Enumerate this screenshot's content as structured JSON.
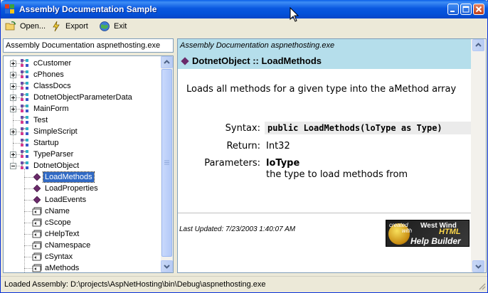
{
  "window": {
    "title": "Assembly Documentation Sample",
    "controls": [
      "minimize",
      "maximize",
      "close"
    ]
  },
  "menu": {
    "open_label": "Open...",
    "export_label": "Export",
    "exit_label": "Exit"
  },
  "path": {
    "value": "Assembly Documentation aspnethosting.exe"
  },
  "tree": {
    "items": [
      {
        "label": "cCustomer",
        "level": 0,
        "expander": "plus",
        "icon": "class-icon"
      },
      {
        "label": "cPhones",
        "level": 0,
        "expander": "plus",
        "icon": "class-icon"
      },
      {
        "label": "ClassDocs",
        "level": 0,
        "expander": "plus",
        "icon": "class-icon"
      },
      {
        "label": "DotnetObjectParameterData",
        "level": 0,
        "expander": "plus",
        "icon": "class-icon"
      },
      {
        "label": "MainForm",
        "level": 0,
        "expander": "plus",
        "icon": "class-icon"
      },
      {
        "label": "Test",
        "level": 0,
        "expander": "none",
        "icon": "class-icon"
      },
      {
        "label": "SimpleScript",
        "level": 0,
        "expander": "plus",
        "icon": "class-icon"
      },
      {
        "label": "Startup",
        "level": 0,
        "expander": "none",
        "icon": "class-icon"
      },
      {
        "label": "TypeParser",
        "level": 0,
        "expander": "plus",
        "icon": "class-icon"
      },
      {
        "label": "DotnetObject",
        "level": 0,
        "expander": "minus",
        "icon": "class-icon"
      },
      {
        "label": "LoadMethods",
        "level": 1,
        "expander": "none",
        "icon": "method-icon",
        "selected": true
      },
      {
        "label": "LoadProperties",
        "level": 1,
        "expander": "none",
        "icon": "method-icon"
      },
      {
        "label": "LoadEvents",
        "level": 1,
        "expander": "none",
        "icon": "method-icon"
      },
      {
        "label": "cName",
        "level": 1,
        "expander": "none",
        "icon": "property-icon"
      },
      {
        "label": "cScope",
        "level": 1,
        "expander": "none",
        "icon": "property-icon"
      },
      {
        "label": "cHelpText",
        "level": 1,
        "expander": "none",
        "icon": "property-icon"
      },
      {
        "label": "cNamespace",
        "level": 1,
        "expander": "none",
        "icon": "property-icon"
      },
      {
        "label": "cSyntax",
        "level": 1,
        "expander": "none",
        "icon": "property-icon"
      },
      {
        "label": "aMethods",
        "level": 1,
        "expander": "none",
        "icon": "property-icon"
      }
    ]
  },
  "doc": {
    "subtitle": "Assembly Documentation aspnethosting.exe",
    "title": "DotnetObject :: LoadMethods",
    "description": "Loads all methods for a given type into the aMethod array",
    "syntax_label": "Syntax:",
    "syntax_value": "public LoadMethods(loType as Type)",
    "return_label": "Return:",
    "return_value": "Int32",
    "params_label": "Parameters:",
    "param_name": "loType",
    "param_desc": "the type to load methods from",
    "updated": "Last Updated: 7/23/2003 1:40:07 AM",
    "badge": {
      "line1": "created",
      "line2": "West Wind",
      "line3": "with",
      "line4": "HTML",
      "line5": "Help Builder"
    }
  },
  "status": {
    "text": "Loaded Assembly: D:\\projects\\AspNetHosting\\bin\\Debug\\aspnethosting.exe"
  },
  "colors": {
    "titlebar": "#0A58E0",
    "selection": "#316AC5",
    "doc_header": "#B5DEEB",
    "method_diamond": "#6A2A6A"
  }
}
